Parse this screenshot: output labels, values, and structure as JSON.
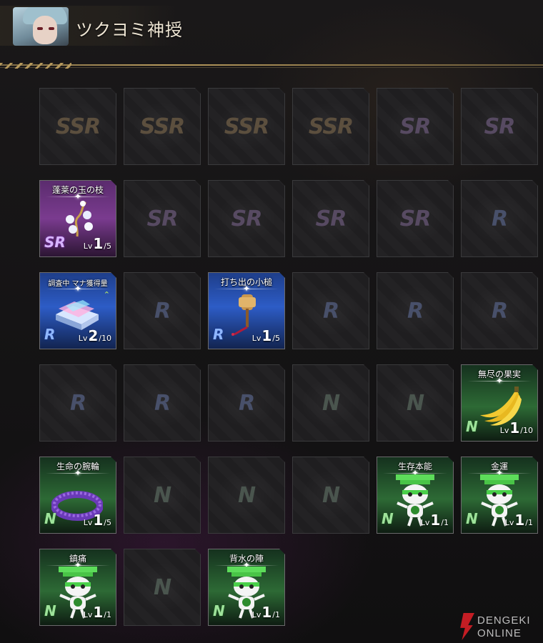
{
  "header": {
    "title": "ツクヨミ神授"
  },
  "watermark": {
    "line1": "DENGEKI",
    "line2": "ONLINE"
  },
  "rows": [
    [
      {
        "type": "empty",
        "rarity": "SSR",
        "label": "SSR"
      },
      {
        "type": "empty",
        "rarity": "SSR",
        "label": "SSR"
      },
      {
        "type": "empty",
        "rarity": "SSR",
        "label": "SSR"
      },
      {
        "type": "empty",
        "rarity": "SSR",
        "label": "SSR"
      },
      {
        "type": "empty",
        "rarity": "SR",
        "label": "SR"
      },
      {
        "type": "empty",
        "rarity": "SR",
        "label": "SR"
      }
    ],
    [
      {
        "type": "card",
        "rarity": "SR",
        "name": "蓬莱の玉の枝",
        "level": "1",
        "max": "/5",
        "icon": "jeweled-branch-icon"
      },
      {
        "type": "empty",
        "rarity": "SR",
        "label": "SR"
      },
      {
        "type": "empty",
        "rarity": "SR",
        "label": "SR"
      },
      {
        "type": "empty",
        "rarity": "SR",
        "label": "SR"
      },
      {
        "type": "empty",
        "rarity": "SR",
        "label": "SR"
      },
      {
        "type": "empty",
        "rarity": "R",
        "label": "R"
      }
    ],
    [
      {
        "type": "card",
        "rarity": "R",
        "name": "調査中 マナ獲得量",
        "level": "2",
        "max": "/10",
        "icon": "mana-ingots-icon",
        "badge": "^"
      },
      {
        "type": "empty",
        "rarity": "R",
        "label": "R"
      },
      {
        "type": "card",
        "rarity": "R",
        "name": "打ち出の小槌",
        "level": "1",
        "max": "/5",
        "icon": "magic-mallet-icon"
      },
      {
        "type": "empty",
        "rarity": "R",
        "label": "R"
      },
      {
        "type": "empty",
        "rarity": "R",
        "label": "R"
      },
      {
        "type": "empty",
        "rarity": "R",
        "label": "R"
      }
    ],
    [
      {
        "type": "empty",
        "rarity": "R",
        "label": "R"
      },
      {
        "type": "empty",
        "rarity": "R",
        "label": "R"
      },
      {
        "type": "empty",
        "rarity": "R",
        "label": "R"
      },
      {
        "type": "empty",
        "rarity": "N",
        "label": "N"
      },
      {
        "type": "empty",
        "rarity": "N",
        "label": "N"
      },
      {
        "type": "card",
        "rarity": "N",
        "name": "無尽の果実",
        "level": "1",
        "max": "/10",
        "icon": "banana-icon"
      }
    ],
    [
      {
        "type": "card",
        "rarity": "N",
        "name": "生命の腕輪",
        "level": "1",
        "max": "/5",
        "icon": "bracelet-icon"
      },
      {
        "type": "empty",
        "rarity": "N",
        "label": "N"
      },
      {
        "type": "empty",
        "rarity": "N",
        "label": "N"
      },
      {
        "type": "empty",
        "rarity": "N",
        "label": "N"
      },
      {
        "type": "card",
        "rarity": "N",
        "name": "生存本能",
        "level": "1",
        "max": "/1",
        "icon": "mascot-icon"
      },
      {
        "type": "card",
        "rarity": "N",
        "name": "金運",
        "level": "1",
        "max": "/1",
        "icon": "mascot-icon"
      }
    ],
    [
      {
        "type": "card",
        "rarity": "N",
        "name": "鎮痛",
        "level": "1",
        "max": "/1",
        "icon": "mascot-icon"
      },
      {
        "type": "empty",
        "rarity": "N",
        "label": "N"
      },
      {
        "type": "card",
        "rarity": "N",
        "name": "背水の陣",
        "level": "1",
        "max": "/1",
        "icon": "mascot-icon"
      }
    ]
  ],
  "labels": {
    "lv": "Lv"
  }
}
